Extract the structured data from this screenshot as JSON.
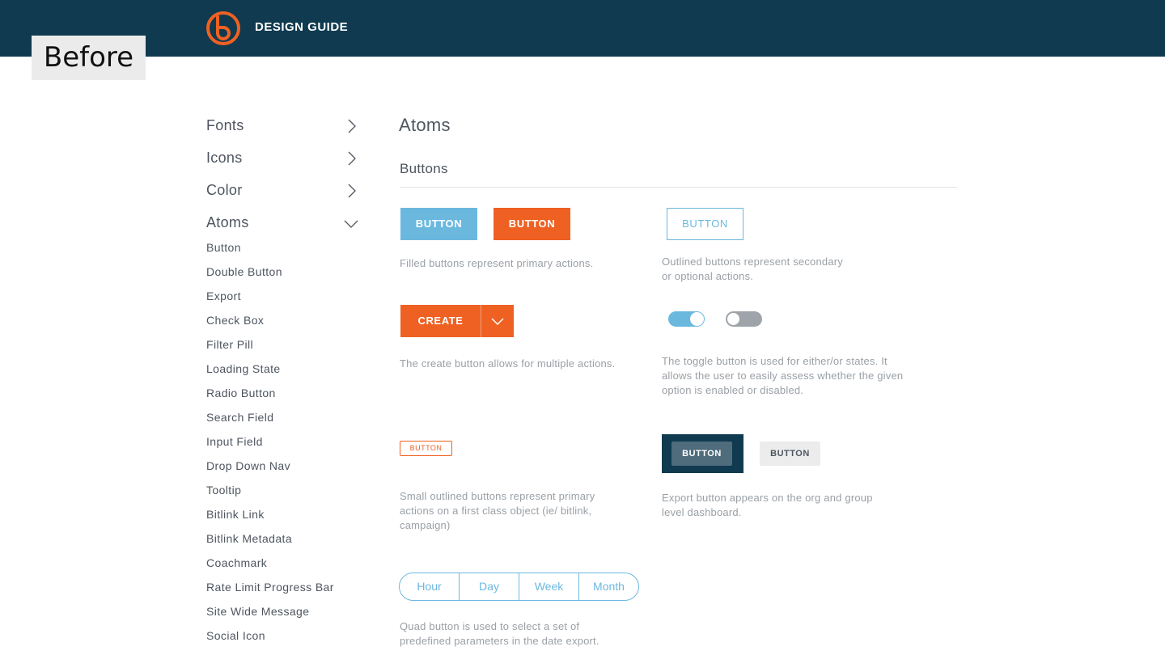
{
  "header": {
    "title": "DESIGN GUIDE",
    "logo_icon": "bitly-logo-icon",
    "background": "#0f3a4f",
    "accent": "#ee6123"
  },
  "badge": {
    "label": "Before"
  },
  "sidebar": {
    "sections": [
      {
        "label": "Fonts",
        "icon": "chevron-right-icon"
      },
      {
        "label": "Icons",
        "icon": "chevron-right-icon"
      },
      {
        "label": "Color",
        "icon": "chevron-right-icon"
      },
      {
        "label": "Atoms",
        "icon": "chevron-down-icon"
      }
    ],
    "items": [
      "Button",
      "Double Button",
      "Export",
      "Check Box",
      "Filter Pill",
      "Loading State",
      "Radio Button",
      "Search Field",
      "Input Field",
      "Drop Down Nav",
      "Tooltip",
      "Bitlink Link",
      "Bitlink Metadata",
      "Coachmark",
      "Rate Limit Progress Bar",
      "Site Wide Message",
      "Social Icon"
    ]
  },
  "main": {
    "title": "Atoms",
    "section": "Buttons",
    "filled_blue_label": "BUTTON",
    "filled_orange_label": "BUTTON",
    "outlined_label": "BUTTON",
    "filled_desc": "Filled buttons represent primary actions.",
    "outlined_desc_1": "Outlined buttons represent secondary",
    "outlined_desc_2": "or optional actions.",
    "create_label": "CREATE",
    "create_desc": "The create button allows for multiple actions.",
    "toggle_on": true,
    "toggle_off": false,
    "toggle_desc_1": "The toggle button is used for either/or states. It",
    "toggle_desc_2": "allows the user to easily assess whether the given",
    "toggle_desc_3": "option is enabled or disabled.",
    "small_outline_label": "BUTTON",
    "small_desc_1": "Small outlined buttons represent primary",
    "small_desc_2": "actions on a first class object (ie/ bitlink,",
    "small_desc_3": "campaign)",
    "export_dark_label": "BUTTON",
    "export_light_label": "BUTTON",
    "export_desc_1": "Export button appears on the org and group",
    "export_desc_2": "level dashboard.",
    "quad": [
      "Hour",
      "Day",
      "Week",
      "Month"
    ],
    "quad_desc_1": "Quad button is used to select a set of",
    "quad_desc_2": "predefined parameters in the date export."
  },
  "colors": {
    "blue": "#6bb8df",
    "orange": "#ee6123",
    "navy": "#0f3a4f",
    "gray": "#9ea4aa"
  }
}
